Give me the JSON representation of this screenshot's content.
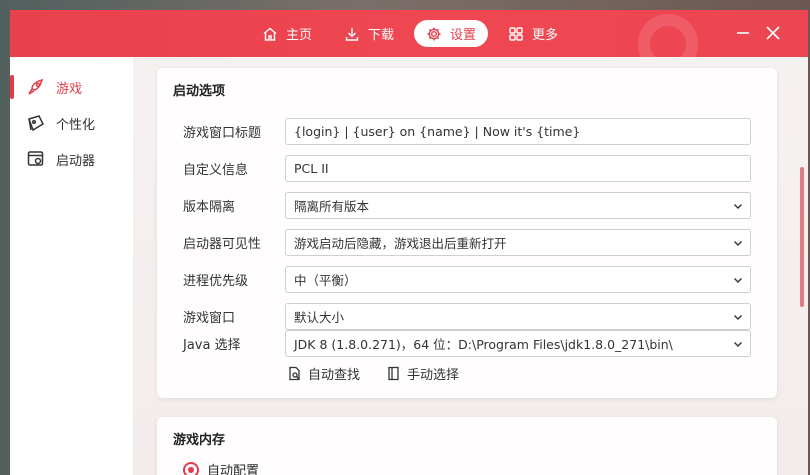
{
  "nav": {
    "items": [
      {
        "label": "主页",
        "icon": "home-icon"
      },
      {
        "label": "下载",
        "icon": "download-icon"
      },
      {
        "label": "设置",
        "icon": "settings-icon",
        "active": true
      },
      {
        "label": "更多",
        "icon": "grid-icon"
      }
    ]
  },
  "window_controls": {
    "minimize": "minimize-icon",
    "close": "close-icon"
  },
  "sidebar": {
    "items": [
      {
        "label": "游戏",
        "icon": "rocket-icon",
        "active": true
      },
      {
        "label": "个性化",
        "icon": "palette-icon"
      },
      {
        "label": "启动器",
        "icon": "launcher-settings-icon"
      }
    ]
  },
  "launch_options": {
    "title": "启动选项",
    "rows": [
      {
        "label": "游戏窗口标题",
        "value": "{login} | {user} on {name} | Now it's {time}",
        "type": "input"
      },
      {
        "label": "自定义信息",
        "value": "PCL II",
        "type": "input"
      },
      {
        "label": "版本隔离",
        "value": "隔离所有版本",
        "type": "select"
      },
      {
        "label": "启动器可见性",
        "value": "游戏启动后隐藏，游戏退出后重新打开",
        "type": "select"
      },
      {
        "label": "进程优先级",
        "value": "中（平衡）",
        "type": "select"
      },
      {
        "label": "游戏窗口",
        "value": "默认大小",
        "type": "select"
      },
      {
        "label": "Java 选择",
        "value": "JDK 8 (1.8.0.271)，64 位：D:\\Program Files\\jdk1.8.0_271\\bin\\",
        "type": "select"
      }
    ],
    "auto_find": "自动查找",
    "manual_select": "手动选择"
  },
  "memory": {
    "title": "游戏内存",
    "auto_config": "自动配置"
  },
  "colors": {
    "accent": "#e33c49",
    "titlebar": "#ef4752"
  }
}
